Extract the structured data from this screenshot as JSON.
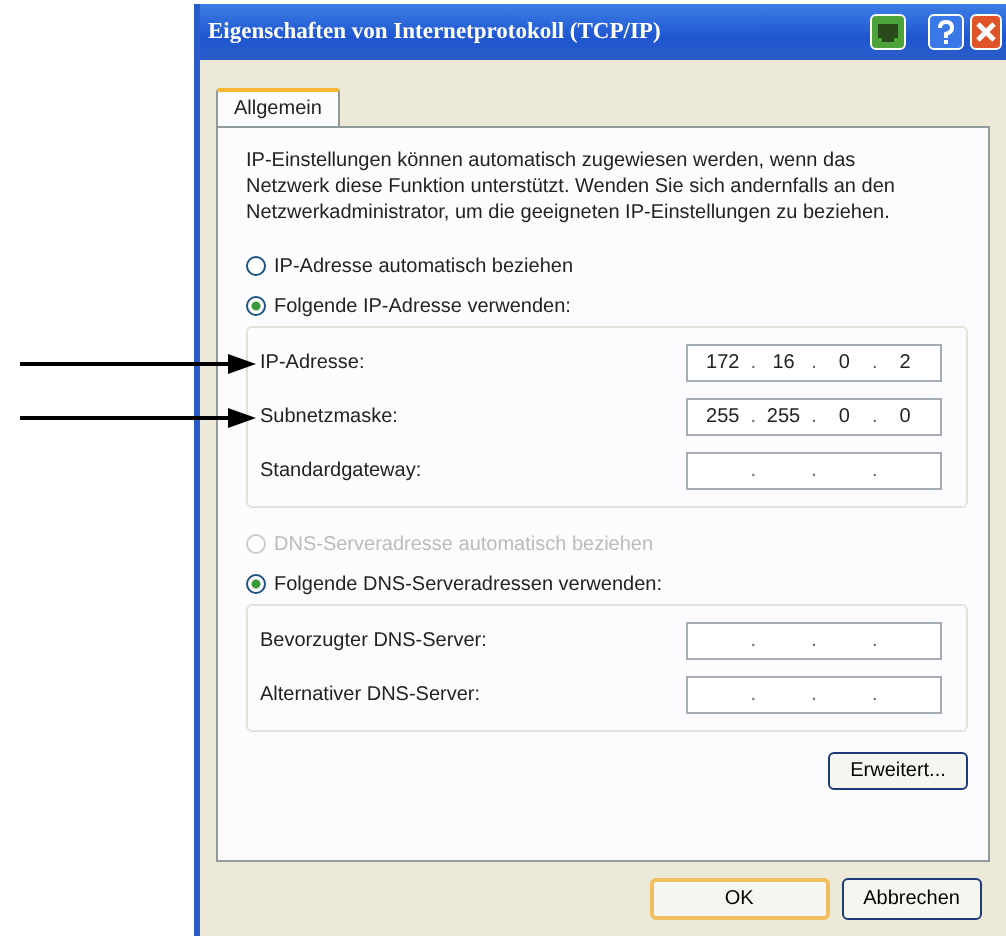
{
  "window": {
    "title": "Eigenschaften von Internetprotokoll (TCP/IP)"
  },
  "tabs": [
    {
      "label": "Allgemein",
      "selected": true
    }
  ],
  "description": "IP-Einstellungen können automatisch zugewiesen werden, wenn das Netzwerk diese Funktion unterstützt. Wenden Sie sich andernfalls an den Netzwerkadministrator, um die geeigneten IP-Einstellungen zu beziehen.",
  "separator": ".",
  "ip_section": {
    "options": [
      {
        "label": "IP-Adresse automatisch beziehen",
        "selected": false,
        "disabled": false
      },
      {
        "label": "Folgende IP-Adresse verwenden:",
        "selected": true,
        "disabled": false
      }
    ],
    "fields": [
      {
        "label": "IP-Adresse:",
        "octets": [
          "172",
          "16",
          "0",
          "2"
        ],
        "arrow": true
      },
      {
        "label": "Subnetzmaske:",
        "octets": [
          "255",
          "255",
          "0",
          "0"
        ],
        "arrow": true
      },
      {
        "label": "Standardgateway:",
        "arrow": false
      }
    ]
  },
  "dns_section": {
    "options": [
      {
        "label": "DNS-Serveradresse automatisch beziehen",
        "selected": false,
        "disabled": true
      },
      {
        "label": "Folgende DNS-Serveradressen verwenden:",
        "selected": true,
        "disabled": false
      }
    ],
    "fields": [
      {
        "label": "Bevorzugter DNS-Server:",
        "arrow": false
      },
      {
        "label": "Alternativer DNS-Server:",
        "arrow": false
      }
    ]
  },
  "advanced_button": "Erweitert...",
  "buttons": [
    {
      "label": "OK",
      "default": true
    },
    {
      "label": "Abbrechen",
      "default": false
    }
  ]
}
